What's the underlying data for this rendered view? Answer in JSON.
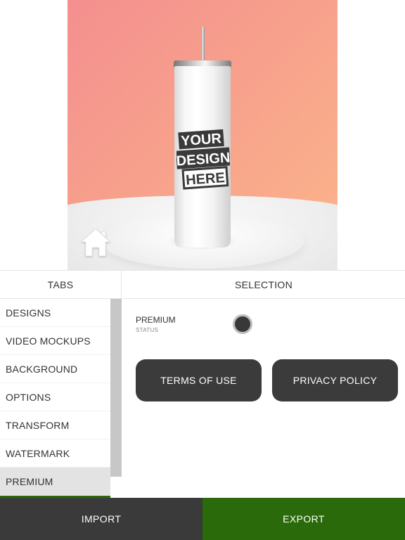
{
  "preview": {
    "design_text": [
      "YOUR",
      "DESIGN",
      "HERE"
    ],
    "home_icon": "home-icon"
  },
  "tabs_panel": {
    "header": "TABS",
    "items": [
      {
        "label": "DESIGNS"
      },
      {
        "label": "VIDEO MOCKUPS"
      },
      {
        "label": "BACKGROUND"
      },
      {
        "label": "OPTIONS"
      },
      {
        "label": "TRANSFORM"
      },
      {
        "label": "WATERMARK"
      },
      {
        "label": "PREMIUM"
      }
    ],
    "active_tab": "PREMIUM"
  },
  "selection_panel": {
    "header": "SELECTION",
    "premium_label": "PREMIUM",
    "premium_sub": "STATUS",
    "terms_label": "TERMS OF USE",
    "privacy_label": "PRIVACY POLICY"
  },
  "bottom_bar": {
    "import_label": "IMPORT",
    "export_label": "EXPORT"
  },
  "colors": {
    "accent_green": "#2a6a0a",
    "dark_button": "#3b3b3b",
    "background_pink": "#f48f8f",
    "background_peach": "#fbb58a"
  }
}
